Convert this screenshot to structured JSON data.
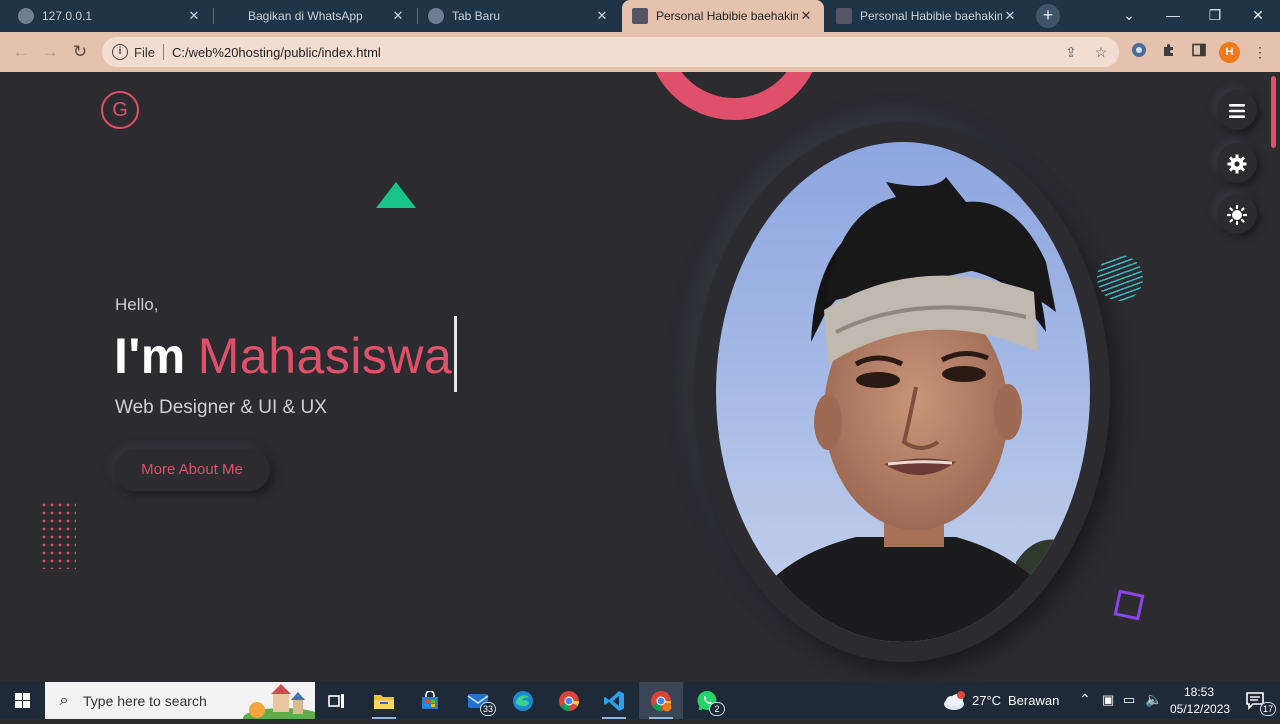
{
  "browser": {
    "tabs": [
      {
        "title": "127.0.0.1",
        "active": false
      },
      {
        "title": "Bagikan di WhatsApp",
        "active": false
      },
      {
        "title": "Tab Baru",
        "active": false
      },
      {
        "title": "Personal Habibie baehakim",
        "active": true
      },
      {
        "title": "Personal Habibie baehakim",
        "active": false
      }
    ],
    "new_tab": "+",
    "close_glyph": "✕",
    "window_controls": {
      "dropdown": "⌄",
      "minimize": "—",
      "restore": "❐",
      "close": "✕"
    },
    "address": {
      "scheme_label": "File",
      "url": "C:/web%20hosting/public/index.html"
    },
    "profile_initial": "H"
  },
  "page": {
    "logo_letter": "G",
    "greeting": "Hello,",
    "headline_lead": "I'm",
    "headline_role": "Mahasiswa",
    "subtitle": "Web Designer & UI & UX",
    "cta_label": "More About Me",
    "photo_alt": "Portrait photo",
    "accent_color": "#e0506a",
    "side_buttons": [
      "menu-icon",
      "gear-icon",
      "sun-icon"
    ]
  },
  "taskbar": {
    "search_placeholder": "Type here to search",
    "mail_badge": "33",
    "whatsapp_badge": "2",
    "weather_temp": "27°C",
    "weather_desc": "Berawan",
    "weather_badge": "1",
    "time": "18:53",
    "date": "05/12/2023",
    "notification_count": "17"
  }
}
